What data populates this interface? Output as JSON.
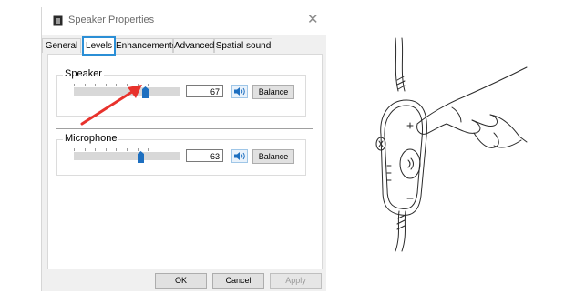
{
  "window": {
    "title": "Speaker Properties",
    "close_glyph": "✕"
  },
  "tabs": [
    {
      "label": "General",
      "active": false
    },
    {
      "label": "Levels",
      "active": true
    },
    {
      "label": "Enhancements",
      "active": false
    },
    {
      "label": "Advanced",
      "active": false
    },
    {
      "label": "Spatial sound",
      "active": false
    }
  ],
  "levels": {
    "speaker": {
      "label": "Speaker",
      "value": "67",
      "balance_label": "Balance",
      "level": 0.67
    },
    "microphone": {
      "label": "Microphone",
      "value": "63",
      "balance_label": "Balance",
      "level": 0.63
    }
  },
  "footer": {
    "ok_label": "OK",
    "cancel_label": "Cancel",
    "apply_label": "Apply"
  },
  "colors": {
    "tab_highlight": "#2b8fd6",
    "annotation_arrow": "#e8322c",
    "slider_thumb": "#1d6fc0"
  },
  "icons": [
    "speaker-properties-icon",
    "close-icon",
    "speaker-volume-icon",
    "arrow-annotation",
    "usb-headset-remote-illustration"
  ]
}
